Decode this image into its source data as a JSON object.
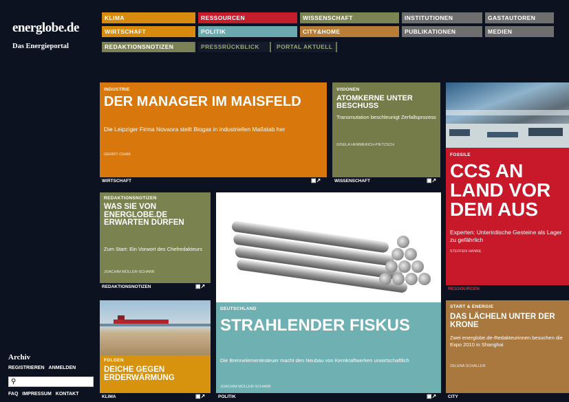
{
  "site": {
    "logo": "energlobe.de",
    "tagline": "Das Energieportal"
  },
  "nav_top": [
    {
      "label": "Klima",
      "color": "#d88a0e"
    },
    {
      "label": "Ressourcen",
      "color": "#c41d2c"
    },
    {
      "label": "Wissenschaft",
      "color": "#7d8453"
    },
    {
      "label": "Institutionen",
      "color": "#6e6e6e"
    },
    {
      "label": "Gastautoren",
      "color": "#6e6e6e"
    }
  ],
  "nav_bottom": [
    {
      "label": "Wirtschaft",
      "color": "#d88a0e"
    },
    {
      "label": "Politik",
      "color": "#6ba9ae"
    },
    {
      "label": "City&Home",
      "color": "#b77d36"
    },
    {
      "label": "Publikationen",
      "color": "#6e6e6e"
    },
    {
      "label": "Medien",
      "color": "#6e6e6e"
    }
  ],
  "nav_sub": [
    "Redaktionsnotizen",
    "Pressrückblick",
    "Portal aktuell"
  ],
  "tiles": {
    "manager": {
      "kicker": "Industrie",
      "headline": "Der Manager im Maisfeld",
      "teaser": "Die Leipziger Firma Novaora stellt Biogas in industriellen Maßstab her",
      "author": "Gerrit Cihak",
      "category": "Wirtschaft",
      "color": "#d8770b"
    },
    "atom": {
      "kicker": "Visionen",
      "headline": "Atomkerne unter Beschuss",
      "teaser": "Transmutation beschleunigt Zerfallsprozess",
      "author": "Gisela Hemmerich-Pietzsch",
      "category": "Wissenschaft",
      "color": "#757c4a"
    },
    "ccs": {
      "kicker": "Fossile",
      "headline": "CCS an Land vor dem Aus",
      "teaser": "Experten: Unterirdische Gesteine als Lager zu gefährlich",
      "author": "Steffen Hanke",
      "category": "Ressourcen",
      "color": "#c8192a"
    },
    "redaktion": {
      "kicker": "Redaktionsnotizen",
      "headline": "Was Sie von energlobe.de erwarten dürfen",
      "teaser": "Zum Start: Ein Vorwort des Chefredakteurs",
      "author": "Joachim Müller-Scharr",
      "category": "Redaktionsnotizen",
      "color": "#7a8250"
    },
    "fiskus": {
      "kicker": "Deutschland",
      "headline": "Strahlender Fiskus",
      "teaser": "Die Brennelementesteuer macht den Neubau von Kernkraftwerken unwirtschaftlich",
      "author": "Joachim Müller-Scharr",
      "category": "Politik",
      "color": "#6fb0b3"
    },
    "deiche": {
      "kicker": "Folgen",
      "headline": "Deiche gegen Erderwärmung",
      "category": "Klima",
      "color": "#d7920e"
    },
    "laecheln": {
      "kicker": "Start & Energie",
      "headline": "Das Lächeln unter der Krone",
      "teaser": "Zwei energlobe.de-Redakteurinnen besuchen die Expo 2010 in Shanghai",
      "author": "Zelena Schaller",
      "category": "City",
      "color": "#a8783f"
    }
  },
  "sidebar": {
    "archiv": "Archiv",
    "registrieren": "Registrieren",
    "anmelden": "Anmelden",
    "search_placeholder": "",
    "faq": "FAQ",
    "impressum": "Impressum",
    "kontakt": "Kontakt"
  },
  "share_icon": "share-icon"
}
